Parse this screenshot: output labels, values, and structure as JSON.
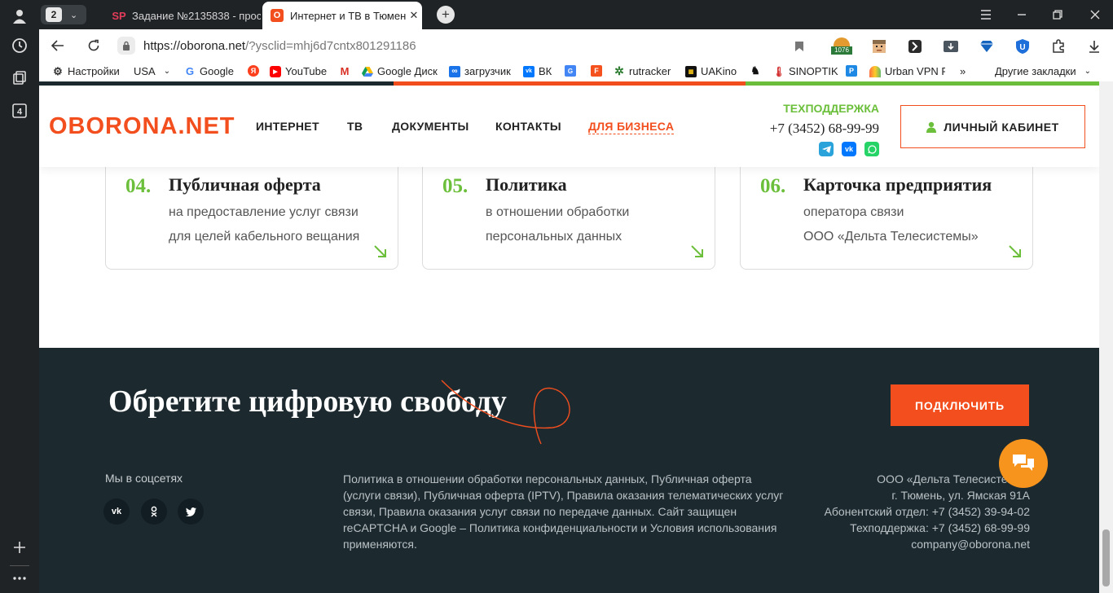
{
  "browser": {
    "tab_counter": "2",
    "tabs": [
      {
        "favicon": "SP",
        "title": "Задание №2135838 - прос"
      },
      {
        "favicon": "O",
        "title": "Интернет и ТВ в Тюмени"
      }
    ],
    "url_domain": "https://oborona.net",
    "url_path": "/?ysclid=mhj6d7cntx801291186",
    "extension_badge": "1076",
    "bookmarks": [
      {
        "icon": "gear-icon",
        "label": "Настройки"
      },
      {
        "icon": "folder",
        "label": "USA"
      },
      {
        "icon": "google-icon",
        "label": "Google"
      },
      {
        "icon": "yandex-icon",
        "label": ""
      },
      {
        "icon": "youtube-icon",
        "label": "YouTube"
      },
      {
        "icon": "gmail-icon",
        "label": ""
      },
      {
        "icon": "drive-icon",
        "label": "Google Диск"
      },
      {
        "icon": "loop-icon",
        "label": "загрузчик"
      },
      {
        "icon": "vk-icon",
        "label": "ВК"
      },
      {
        "icon": "translate-icon",
        "label": ""
      },
      {
        "icon": "f-icon",
        "label": ""
      },
      {
        "icon": "rutracker-icon",
        "label": "rutracker"
      },
      {
        "icon": "uakino-icon",
        "label": "UAKino"
      },
      {
        "icon": "chess-icon",
        "label": ""
      },
      {
        "icon": "thermometer-icon",
        "label": "SINOPTIK"
      },
      {
        "icon": "p-icon",
        "label": ""
      },
      {
        "icon": "vpn-icon",
        "label": "Urban VPN P"
      }
    ],
    "more_bookmarks": "»",
    "other_bookmarks": "Другие закладки"
  },
  "header": {
    "logo": "OBORONA.NET",
    "menu": [
      "ИНТЕРНЕТ",
      "ТВ",
      "ДОКУМЕНТЫ",
      "КОНТАКТЫ",
      "ДЛЯ БИЗНЕСА"
    ],
    "support_label": "ТЕХПОДДЕРЖКА",
    "support_phone": "+7 (3452) 68-99-99",
    "cabinet_button": "ЛИЧНЫЙ КАБИНЕТ"
  },
  "cards": [
    {
      "num": "04.",
      "title": "Публичная оферта",
      "line1": "на предоставление услуг связи",
      "line2": "для целей кабельного вещания"
    },
    {
      "num": "05.",
      "title": "Политика",
      "line1": "в отношении обработки",
      "line2": "персональных данных"
    },
    {
      "num": "06.",
      "title": "Карточка предприятия",
      "line1": "оператора связи",
      "line2": "ООО «Дельта Телесистемы»"
    }
  ],
  "footer": {
    "slogan": "Обретите цифровую свободу",
    "connect_button": "ПОДКЛЮЧИТЬ",
    "social_title": "Мы в соцсетях",
    "policy_text": "Политика в отношении обработки персональных данных, Публичная оферта (услуги связи), Публичная оферта (IPTV), Правила оказания телематических услуг связи, Правила оказания услуг связи по передаче данных. Сайт защищен reCAPTCHA и Google – Политика конфиденциальности и Условия использования применяются.",
    "contacts": [
      "ООО «Дельта Телесистемы»",
      "г. Тюмень, ул. Ямская 91А",
      "Абонентский отдел: +7 (3452) 39-94-02",
      "Техподдержка: +7 (3452) 68-99-99",
      "company@oborona.net"
    ]
  },
  "colors": {
    "brand_orange": "#f24e1e",
    "accent_green": "#6bbf3b",
    "footer_bg": "#1c2a30"
  }
}
